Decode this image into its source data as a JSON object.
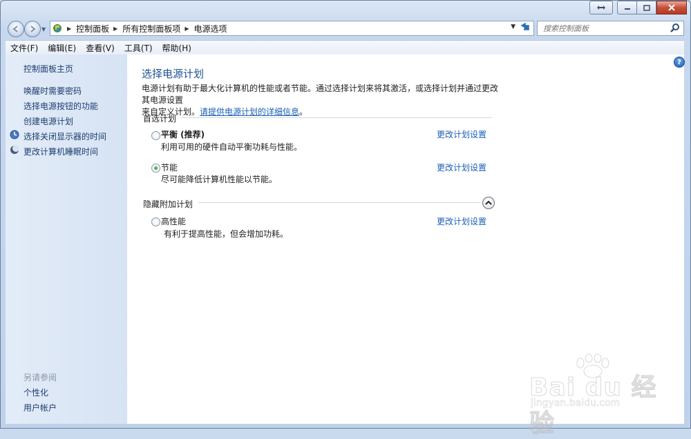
{
  "window": {
    "caption_buttons": [
      "restore-swap",
      "minimize",
      "maximize",
      "close"
    ]
  },
  "address_bar": {
    "breadcrumbs": [
      "控制面板",
      "所有控制面板项",
      "电源选项"
    ]
  },
  "search": {
    "placeholder": "搜索控制面板"
  },
  "menu": {
    "items": [
      "文件(F)",
      "编辑(E)",
      "查看(V)",
      "工具(T)",
      "帮助(H)"
    ]
  },
  "sidebar": {
    "home": "控制面板主页",
    "links": [
      "唤醒时需要密码",
      "选择电源按钮的功能",
      "创建电源计划",
      "选择关闭显示器的时间",
      "更改计算机睡眠时间"
    ],
    "see_also_heading": "另请参阅",
    "see_also": [
      "个性化",
      "用户帐户"
    ]
  },
  "main": {
    "title": "选择电源计划",
    "description_line1": "电源计划有助于最大化计算机的性能或者节能。通过选择计划来将其激活，或选择计划并通过更改其电源设置",
    "description_line2_prefix": "来自定义计划。",
    "description_link": "请提供电源计划的详细信息",
    "description_line2_suffix": "。",
    "preferred_heading": "首选计划",
    "hidden_heading": "隐藏附加计划",
    "plans": [
      {
        "name": "平衡 (推荐)",
        "desc": "利用可用的硬件自动平衡功耗与性能。",
        "link": "更改计划设置",
        "selected": false
      },
      {
        "name": "节能",
        "desc": "尽可能降低计算机性能以节能。",
        "link": "更改计划设置",
        "selected": true
      },
      {
        "name": "高性能",
        "desc": "有利于提高性能，但会增加功耗。",
        "link": "更改计划设置",
        "selected": false
      }
    ]
  },
  "watermark": {
    "logo": "Bai du 经验",
    "url": "jingyan.baidu.com"
  },
  "colors": {
    "link": "#1a5fb4",
    "title": "#1d4f91",
    "sidebar_link": "#1b3d6e",
    "close_button": "#c7503b"
  }
}
